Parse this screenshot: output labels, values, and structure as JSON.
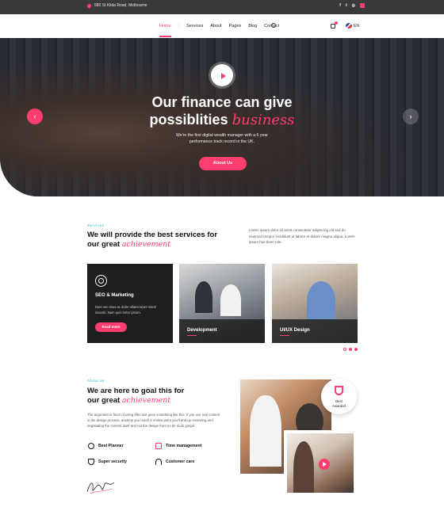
{
  "topbar": {
    "address": "580 St Kilda Road, Melbourne",
    "social": [
      "f",
      "t",
      "◎"
    ]
  },
  "nav": {
    "items": [
      "Home",
      "Services",
      "About",
      "Pages",
      "Blog",
      "Contact"
    ],
    "lang": "EN"
  },
  "hero": {
    "title_line1": "Our finance can give",
    "title_line2_plain": "possiblities",
    "title_line2_accent": "business",
    "subtitle": "We're the first digital wealth manager with a 6 year performance track record in the UK.",
    "cta": "About Us",
    "prev": "‹",
    "next": "›"
  },
  "services": {
    "tag": "Services",
    "heading_line1": "We will provide the best services for",
    "heading_line2_plain": "our great",
    "heading_line2_accent": "achievement",
    "text": "Lorem ipsum dolor sit amet consectetur adipiscing elit sed do eiusmod tempor incididunt ut labore et dolore magna aliqua. Lorem ipsum has been role.",
    "cards": [
      {
        "title": "SEO & Marketing",
        "text": "Duis nec risus ac dolor ullamcorper morel iosaolo. Nam quis tortor ipsum.",
        "button": "Read more"
      },
      {
        "title": "Development"
      },
      {
        "title": "UI/UX Design"
      }
    ]
  },
  "about": {
    "tag": "About us",
    "heading_line1": "We are here to goal this for",
    "heading_line2_plain": "our great",
    "heading_line2_accent": "achievement",
    "text": "The argument in favor of using filler text goes something like this: If you use real content in the design process, anytime you reach a review point you'll end up reviewing and negotiating the content itself and not the design from so de mulo gorgol.",
    "features": [
      "Best Planner",
      "Time management",
      "Super security",
      "Customer care"
    ],
    "award": {
      "line1": "Best",
      "line2": "Awarded"
    }
  },
  "colors": {
    "accent": "#ff3d6e",
    "teal": "#18b7c9",
    "dark": "#1f1d1f"
  }
}
